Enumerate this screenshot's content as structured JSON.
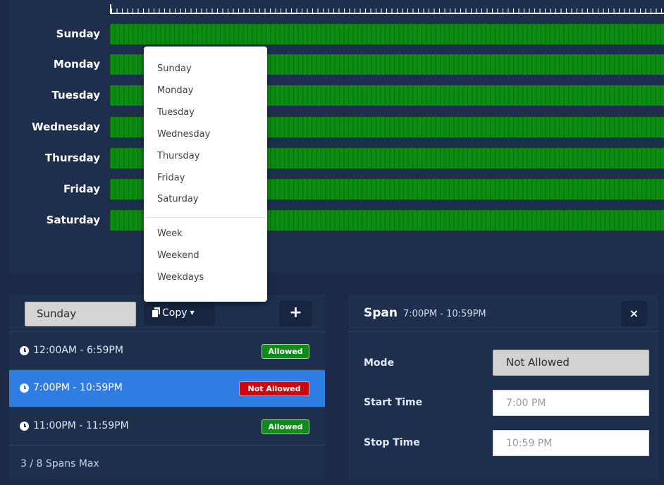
{
  "schedule": {
    "days": [
      "Sunday",
      "Monday",
      "Tuesday",
      "Wednesday",
      "Thursday",
      "Friday",
      "Saturday"
    ],
    "bar_color": "#0c8c12"
  },
  "span_list": {
    "day_select": "Sunday",
    "copy_label": "Copy",
    "add_label": "+",
    "spans": [
      {
        "range": "12:00AM - 6:59PM",
        "status": "Allowed",
        "selected": false
      },
      {
        "range": "7:00PM - 10:59PM",
        "status": "Not Allowed",
        "selected": true
      },
      {
        "range": "11:00PM - 11:59PM",
        "status": "Allowed",
        "selected": false
      }
    ],
    "footer": "3 / 8 Spans Max"
  },
  "span_detail": {
    "title": "Span",
    "range": "7:00PM - 10:59PM",
    "close_label": "×",
    "mode_label": "Mode",
    "mode_value": "Not Allowed",
    "start_label": "Start Time",
    "start_value": "7:00 PM",
    "stop_label": "Stop Time",
    "stop_value": "10:59 PM"
  },
  "copy_menu": {
    "days": [
      "Sunday",
      "Monday",
      "Tuesday",
      "Wednesday",
      "Thursday",
      "Friday",
      "Saturday"
    ],
    "groups": [
      "Week",
      "Weekend",
      "Weekdays"
    ]
  },
  "colors": {
    "allowed": "#108a18",
    "not_allowed": "#c9070e",
    "selected_row": "#2f7de3",
    "panel": "#1e2f4e"
  }
}
